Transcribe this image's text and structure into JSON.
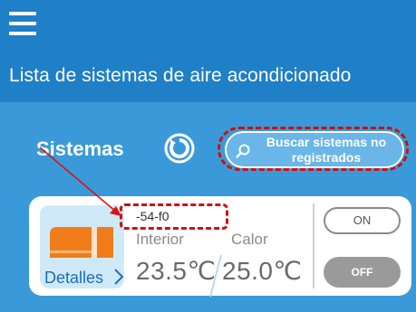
{
  "header": {
    "menu_icon": "hamburger-menu-icon",
    "title": "Lista de sistemas de aire acondicionado"
  },
  "section": {
    "label": "Sistemas",
    "refresh_icon": "refresh-icon"
  },
  "search": {
    "icon": "search-icon",
    "label_line1": "Buscar sistemas no",
    "label_line2": "registrados"
  },
  "system": {
    "name": "-54-f0",
    "image_icon": "air-conditioner-icon",
    "details_label": "Detalles",
    "details_icon": "chevron-right-icon",
    "interior_label": "Interior",
    "interior_temp": "23.5℃",
    "mode_label": "Calor",
    "set_temp": "25.0℃",
    "on_label": "ON",
    "off_label": "OFF"
  },
  "colors": {
    "header_bg": "#1f7fc7",
    "background": "#3a9ad9",
    "annotation": "#cc1111",
    "off_button": "#9a9a9a"
  }
}
